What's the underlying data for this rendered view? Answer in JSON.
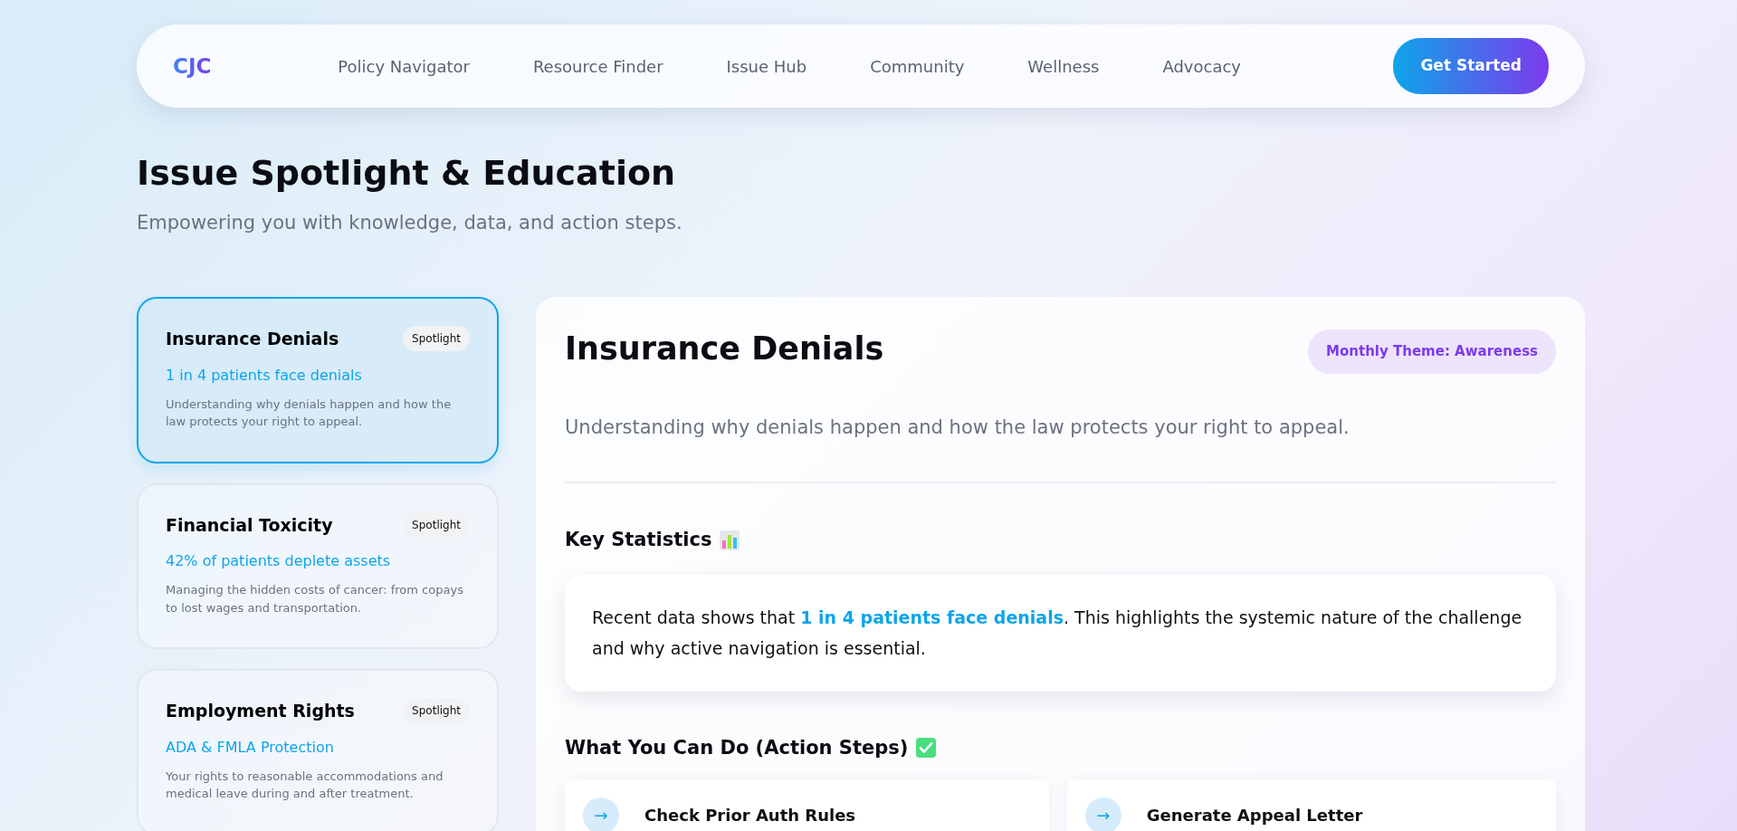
{
  "nav": {
    "logo": "CJC",
    "links": [
      {
        "label": "Policy Navigator",
        "selected": false
      },
      {
        "label": "Resource Finder",
        "selected": false
      },
      {
        "label": "Issue Hub",
        "selected": false
      },
      {
        "label": "Community",
        "selected": false
      },
      {
        "label": "Wellness",
        "selected": false
      },
      {
        "label": "Advocacy",
        "selected": false
      }
    ],
    "cta": "Get Started"
  },
  "header": {
    "title": "Issue Spotlight & Education",
    "subtitle": "Empowering you with knowledge, data, and action steps."
  },
  "issues": [
    {
      "title": "Insurance Denials",
      "badge": "Spotlight",
      "stat": "1 in 4 patients face denials",
      "description": "Understanding why denials happen and how the law protects your right to appeal.",
      "selected": true
    },
    {
      "title": "Financial Toxicity",
      "badge": "Spotlight",
      "stat": "42% of patients deplete assets",
      "description": "Managing the hidden costs of cancer: from copays to lost wages and transportation.",
      "selected": false
    },
    {
      "title": "Employment Rights",
      "badge": "Spotlight",
      "stat": "ADA & FMLA Protection",
      "description": "Your rights to reasonable accommodations and medical leave during and after treatment.",
      "selected": false
    }
  ],
  "detail": {
    "title": "Insurance Denials",
    "theme_badge": "Monthly Theme: Awareness",
    "description": "Understanding why denials happen and how the law protects your right to appeal.",
    "stats_heading": "Key Statistics",
    "stats_text": "Recent data shows that **1 in 4 patients face denials**. This highlights the systemic nature of the challenge and why active navigation is essential.",
    "actions_heading": "What You Can Do (Action Steps)",
    "actions": [
      {
        "icon": "→",
        "label": "Check Prior Auth Rules"
      },
      {
        "icon": "→",
        "label": "Generate Appeal Letter"
      }
    ]
  }
}
